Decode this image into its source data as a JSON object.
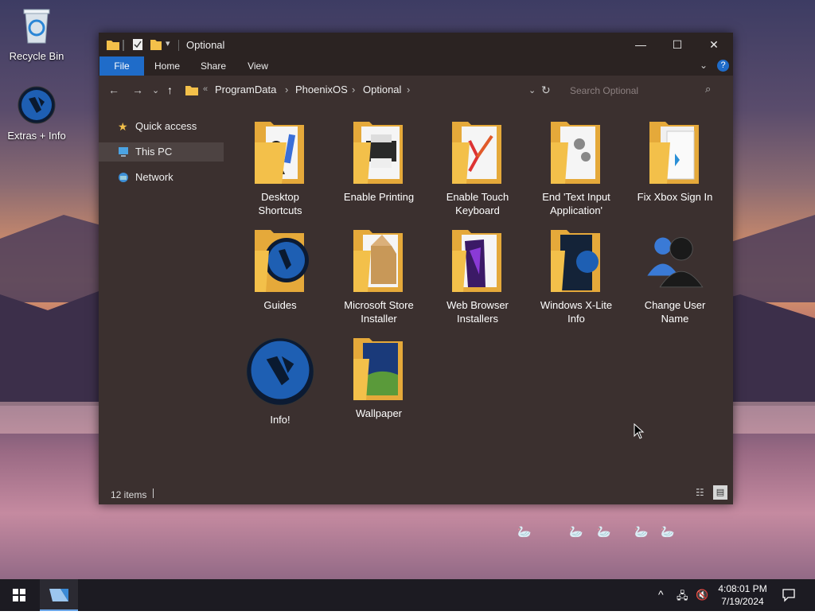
{
  "desktop": {
    "icons": [
      {
        "label": "Recycle Bin",
        "icon": "recycle-bin-icon"
      },
      {
        "label": "Extras + Info",
        "icon": "phoenix-logo-icon"
      }
    ]
  },
  "window": {
    "title": "Optional",
    "ribbon_tabs": [
      "File",
      "Home",
      "Share",
      "View"
    ],
    "breadcrumb": {
      "prefix": "«",
      "parts": [
        "ProgramData",
        "PhoenixOS",
        "Optional"
      ]
    },
    "search_placeholder": "Search Optional",
    "nav_pane": [
      {
        "label": "Quick access",
        "icon": "star-icon",
        "selected": false
      },
      {
        "label": "This PC",
        "icon": "computer-icon",
        "selected": true
      },
      {
        "label": "Network",
        "icon": "network-icon",
        "selected": false
      }
    ],
    "items": [
      {
        "label_1": "Desktop",
        "label_2": "Shortcuts",
        "icon": "folder-icon"
      },
      {
        "label_1": "Enable Printing",
        "label_2": "",
        "icon": "folder-printer-icon"
      },
      {
        "label_1": "Enable Touch",
        "label_2": "Keyboard",
        "icon": "folder-icon"
      },
      {
        "label_1": "End 'Text Input",
        "label_2": "Application'",
        "icon": "folder-gear-icon"
      },
      {
        "label_1": "Fix Xbox Sign In",
        "label_2": "",
        "icon": "folder-icon"
      },
      {
        "label_1": "Guides",
        "label_2": "",
        "icon": "folder-logo-icon"
      },
      {
        "label_1": "Microsoft Store",
        "label_2": "Installer",
        "icon": "folder-box-icon"
      },
      {
        "label_1": "Web Browser",
        "label_2": "Installers",
        "icon": "folder-icon"
      },
      {
        "label_1": "Windows X-Lite",
        "label_2": "Info",
        "icon": "folder-icon"
      },
      {
        "label_1": "Change User",
        "label_2": "Name",
        "icon": "users-icon"
      },
      {
        "label_1": "Info!",
        "label_2": "",
        "icon": "phoenix-logo-icon"
      },
      {
        "label_1": "Wallpaper",
        "label_2": "",
        "icon": "folder-image-icon"
      }
    ],
    "status": "12 items"
  },
  "taskbar": {
    "time": "4:08:01 PM",
    "date": "7/19/2024"
  },
  "colors": {
    "accent": "#1f6cc9",
    "window_bg": "#3b302f",
    "titlebar_bg": "#2b2322",
    "folder": "#f3c04a"
  }
}
